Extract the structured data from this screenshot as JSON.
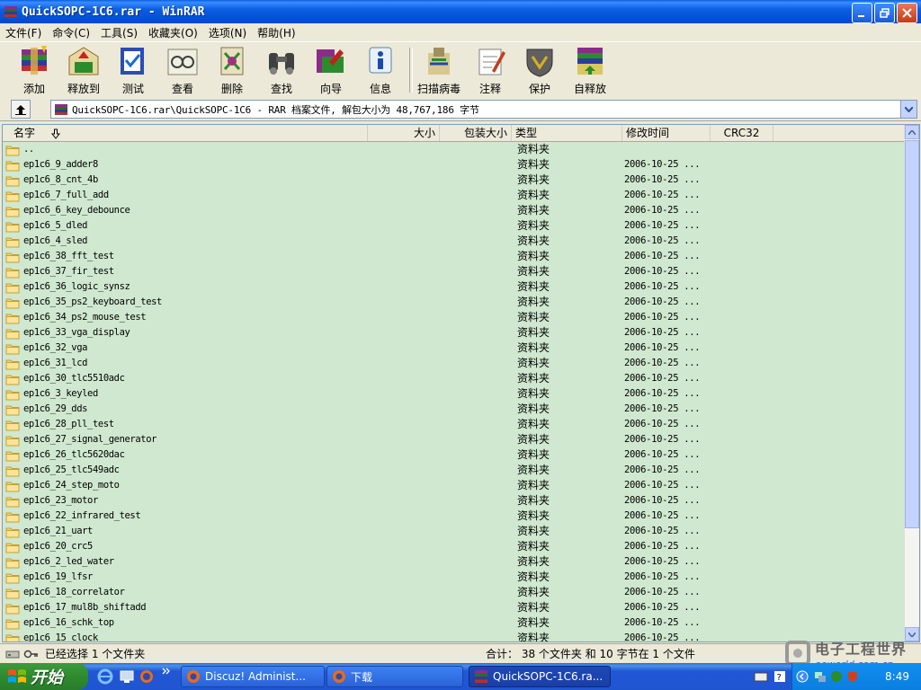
{
  "window": {
    "title": "QuickSOPC-1C6.rar - WinRAR"
  },
  "menu": [
    {
      "label": "文件(F)"
    },
    {
      "label": "命令(C)"
    },
    {
      "label": "工具(S)"
    },
    {
      "label": "收藏夹(O)"
    },
    {
      "label": "选项(N)"
    },
    {
      "label": "帮助(H)"
    }
  ],
  "toolbar": [
    {
      "label": "添加",
      "icon": "add-icon"
    },
    {
      "label": "释放到",
      "icon": "extract-to-icon"
    },
    {
      "label": "测试",
      "icon": "test-icon"
    },
    {
      "label": "查看",
      "icon": "view-icon"
    },
    {
      "label": "删除",
      "icon": "delete-icon"
    },
    {
      "label": "查找",
      "icon": "find-icon"
    },
    {
      "label": "向导",
      "icon": "wizard-icon"
    },
    {
      "label": "信息",
      "icon": "info-icon"
    },
    {
      "label": "扫描病毒",
      "icon": "virus-scan-icon"
    },
    {
      "label": "注释",
      "icon": "comment-icon"
    },
    {
      "label": "保护",
      "icon": "protect-icon"
    },
    {
      "label": "自释放",
      "icon": "sfx-icon"
    }
  ],
  "address": {
    "path": "QuickSOPC-1C6.rar\\QuickSOPC-1C6 - RAR 档案文件, 解包大小为 48,767,186 字节"
  },
  "columns": {
    "name": "名字",
    "size": "大小",
    "packed": "包装大小",
    "type": "类型",
    "modified": "修改时间",
    "crc": "CRC32"
  },
  "files": [
    {
      "name": "..",
      "type": "资料夹",
      "modified": ""
    },
    {
      "name": "ep1c6_9_adder8",
      "type": "资料夹",
      "modified": "2006-10-25 ..."
    },
    {
      "name": "ep1c6_8_cnt_4b",
      "type": "资料夹",
      "modified": "2006-10-25 ..."
    },
    {
      "name": "ep1c6_7_full_add",
      "type": "资料夹",
      "modified": "2006-10-25 ..."
    },
    {
      "name": "ep1c6_6_key_debounce",
      "type": "资料夹",
      "modified": "2006-10-25 ..."
    },
    {
      "name": "ep1c6_5_dled",
      "type": "资料夹",
      "modified": "2006-10-25 ..."
    },
    {
      "name": "ep1c6_4_sled",
      "type": "资料夹",
      "modified": "2006-10-25 ..."
    },
    {
      "name": "ep1c6_38_fft_test",
      "type": "资料夹",
      "modified": "2006-10-25 ..."
    },
    {
      "name": "ep1c6_37_fir_test",
      "type": "资料夹",
      "modified": "2006-10-25 ..."
    },
    {
      "name": "ep1c6_36_logic_synsz",
      "type": "资料夹",
      "modified": "2006-10-25 ..."
    },
    {
      "name": "ep1c6_35_ps2_keyboard_test",
      "type": "资料夹",
      "modified": "2006-10-25 ..."
    },
    {
      "name": "ep1c6_34_ps2_mouse_test",
      "type": "资料夹",
      "modified": "2006-10-25 ..."
    },
    {
      "name": "ep1c6_33_vga_display",
      "type": "资料夹",
      "modified": "2006-10-25 ..."
    },
    {
      "name": "ep1c6_32_vga",
      "type": "资料夹",
      "modified": "2006-10-25 ..."
    },
    {
      "name": "ep1c6_31_lcd",
      "type": "资料夹",
      "modified": "2006-10-25 ..."
    },
    {
      "name": "ep1c6_30_tlc5510adc",
      "type": "资料夹",
      "modified": "2006-10-25 ..."
    },
    {
      "name": "ep1c6_3_keyled",
      "type": "资料夹",
      "modified": "2006-10-25 ..."
    },
    {
      "name": "ep1c6_29_dds",
      "type": "资料夹",
      "modified": "2006-10-25 ..."
    },
    {
      "name": "ep1c6_28_pll_test",
      "type": "资料夹",
      "modified": "2006-10-25 ..."
    },
    {
      "name": "ep1c6_27_signal_generator",
      "type": "资料夹",
      "modified": "2006-10-25 ..."
    },
    {
      "name": "ep1c6_26_tlc5620dac",
      "type": "资料夹",
      "modified": "2006-10-25 ..."
    },
    {
      "name": "ep1c6_25_tlc549adc",
      "type": "资料夹",
      "modified": "2006-10-25 ..."
    },
    {
      "name": "ep1c6_24_step_moto",
      "type": "资料夹",
      "modified": "2006-10-25 ..."
    },
    {
      "name": "ep1c6_23_motor",
      "type": "资料夹",
      "modified": "2006-10-25 ..."
    },
    {
      "name": "ep1c6_22_infrared_test",
      "type": "资料夹",
      "modified": "2006-10-25 ..."
    },
    {
      "name": "ep1c6_21_uart",
      "type": "资料夹",
      "modified": "2006-10-25 ..."
    },
    {
      "name": "ep1c6_20_crc5",
      "type": "资料夹",
      "modified": "2006-10-25 ..."
    },
    {
      "name": "ep1c6_2_led_water",
      "type": "资料夹",
      "modified": "2006-10-25 ..."
    },
    {
      "name": "ep1c6_19_lfsr",
      "type": "资料夹",
      "modified": "2006-10-25 ..."
    },
    {
      "name": "ep1c6_18_correlator",
      "type": "资料夹",
      "modified": "2006-10-25 ..."
    },
    {
      "name": "ep1c6_17_mul8b_shiftadd",
      "type": "资料夹",
      "modified": "2006-10-25 ..."
    },
    {
      "name": "ep1c6_16_schk_top",
      "type": "资料夹",
      "modified": "2006-10-25 ..."
    },
    {
      "name": "ep1c6_15_clock",
      "type": "资料夹",
      "modified": "2006-10-25 ..."
    }
  ],
  "status": {
    "left": "已经选择 1 个文件夹",
    "right": "合计： 38 个文件夹 和 10 字节在 1 个文件"
  },
  "watermark": {
    "cn": "电子工程世界",
    "url": "eeworld.com.cn"
  },
  "taskbar": {
    "start": "开始",
    "tasks": [
      {
        "label": "Discuz! Administ..."
      },
      {
        "label": "下载"
      },
      {
        "label": "QuickSOPC-1C6.ra..."
      }
    ],
    "clock": "8:49"
  },
  "colors": {
    "list_bg": "#cfe8cf",
    "titlebar": "#0a5fe0",
    "taskbar": "#2157d7",
    "start": "#2f8a2f"
  }
}
